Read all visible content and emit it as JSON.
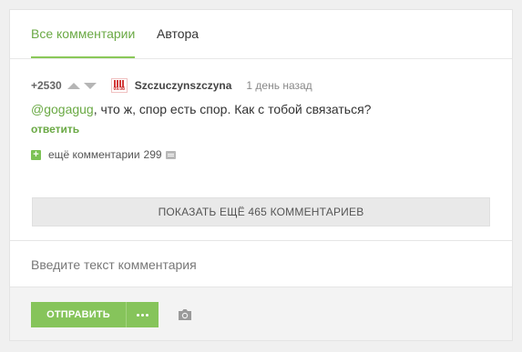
{
  "tabs": [
    {
      "label": "Все комментарии",
      "active": true
    },
    {
      "label": "Автора",
      "active": false
    }
  ],
  "comment": {
    "rating": "+2530",
    "avatar_label": "09.08",
    "username": "Szczuczynszczyna",
    "time": "1 день назад",
    "mention": "@gogagug",
    "text": ", что ж, спор есть спор. Как с тобой связаться?",
    "reply_label": "ответить",
    "more_label": "ещё комментарии",
    "more_count": "299"
  },
  "show_more_label": "ПОКАЗАТЬ ЕЩЁ 465 КОММЕНТАРИЕВ",
  "input": {
    "placeholder": "Введите текст комментария"
  },
  "footer": {
    "send_label": "ОТПРАВИТЬ"
  },
  "colors": {
    "accent": "#86c45b",
    "link": "#6aa944"
  },
  "icons": [
    "arrow-up-icon",
    "arrow-down-icon",
    "plus-icon",
    "message-icon",
    "more-dots-icon",
    "camera-icon"
  ]
}
